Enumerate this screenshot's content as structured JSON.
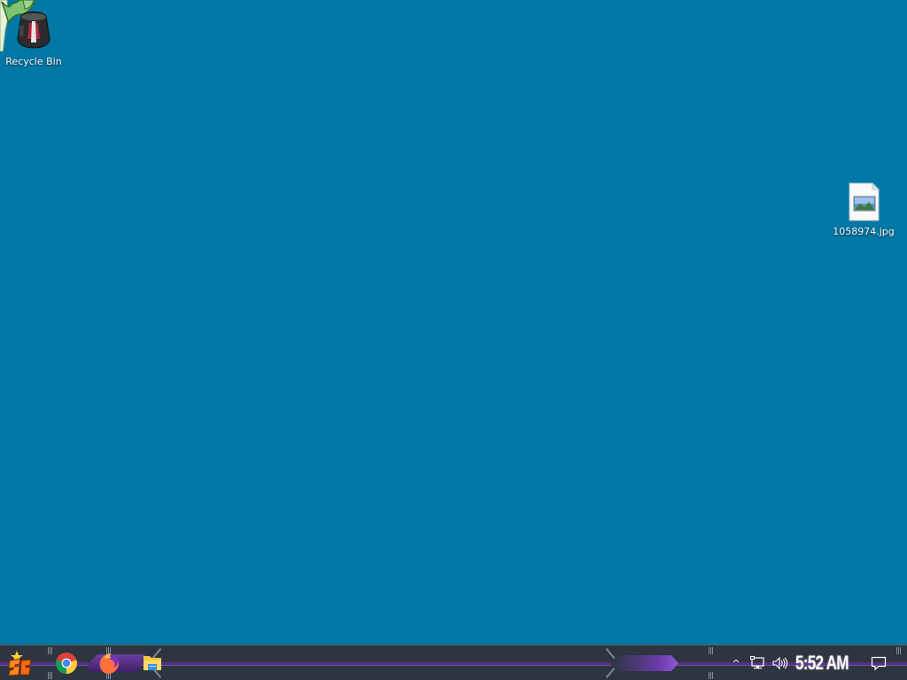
{
  "desktop": {
    "background": "#0077a5",
    "icons": [
      {
        "label": "Recycle Bin",
        "icon": "recycle-bin-icon"
      },
      {
        "label": "1058974.jpg",
        "icon": "image-file-icon"
      }
    ]
  },
  "taskbar": {
    "background": "#2c3540",
    "accent": "#5a2d89",
    "pinned": [
      {
        "icon": "start-menu-icon"
      },
      {
        "icon": "chrome-icon"
      },
      {
        "icon": "firefox-icon"
      },
      {
        "icon": "file-explorer-icon"
      }
    ],
    "tray": {
      "chevron": "^",
      "network_icon": "network-icon",
      "volume_icon": "volume-icon",
      "time": "5:52 AM",
      "action_center_icon": "action-center-icon"
    }
  }
}
